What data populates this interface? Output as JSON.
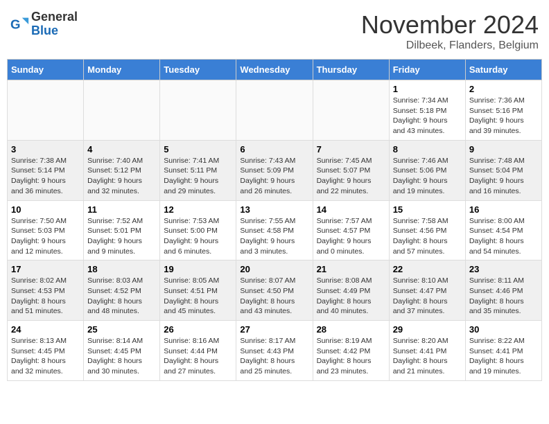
{
  "logo": {
    "general": "General",
    "blue": "Blue"
  },
  "title": {
    "month": "November 2024",
    "location": "Dilbeek, Flanders, Belgium"
  },
  "headers": [
    "Sunday",
    "Monday",
    "Tuesday",
    "Wednesday",
    "Thursday",
    "Friday",
    "Saturday"
  ],
  "weeks": [
    [
      {
        "day": "",
        "info": ""
      },
      {
        "day": "",
        "info": ""
      },
      {
        "day": "",
        "info": ""
      },
      {
        "day": "",
        "info": ""
      },
      {
        "day": "",
        "info": ""
      },
      {
        "day": "1",
        "info": "Sunrise: 7:34 AM\nSunset: 5:18 PM\nDaylight: 9 hours and 43 minutes."
      },
      {
        "day": "2",
        "info": "Sunrise: 7:36 AM\nSunset: 5:16 PM\nDaylight: 9 hours and 39 minutes."
      }
    ],
    [
      {
        "day": "3",
        "info": "Sunrise: 7:38 AM\nSunset: 5:14 PM\nDaylight: 9 hours and 36 minutes."
      },
      {
        "day": "4",
        "info": "Sunrise: 7:40 AM\nSunset: 5:12 PM\nDaylight: 9 hours and 32 minutes."
      },
      {
        "day": "5",
        "info": "Sunrise: 7:41 AM\nSunset: 5:11 PM\nDaylight: 9 hours and 29 minutes."
      },
      {
        "day": "6",
        "info": "Sunrise: 7:43 AM\nSunset: 5:09 PM\nDaylight: 9 hours and 26 minutes."
      },
      {
        "day": "7",
        "info": "Sunrise: 7:45 AM\nSunset: 5:07 PM\nDaylight: 9 hours and 22 minutes."
      },
      {
        "day": "8",
        "info": "Sunrise: 7:46 AM\nSunset: 5:06 PM\nDaylight: 9 hours and 19 minutes."
      },
      {
        "day": "9",
        "info": "Sunrise: 7:48 AM\nSunset: 5:04 PM\nDaylight: 9 hours and 16 minutes."
      }
    ],
    [
      {
        "day": "10",
        "info": "Sunrise: 7:50 AM\nSunset: 5:03 PM\nDaylight: 9 hours and 12 minutes."
      },
      {
        "day": "11",
        "info": "Sunrise: 7:52 AM\nSunset: 5:01 PM\nDaylight: 9 hours and 9 minutes."
      },
      {
        "day": "12",
        "info": "Sunrise: 7:53 AM\nSunset: 5:00 PM\nDaylight: 9 hours and 6 minutes."
      },
      {
        "day": "13",
        "info": "Sunrise: 7:55 AM\nSunset: 4:58 PM\nDaylight: 9 hours and 3 minutes."
      },
      {
        "day": "14",
        "info": "Sunrise: 7:57 AM\nSunset: 4:57 PM\nDaylight: 9 hours and 0 minutes."
      },
      {
        "day": "15",
        "info": "Sunrise: 7:58 AM\nSunset: 4:56 PM\nDaylight: 8 hours and 57 minutes."
      },
      {
        "day": "16",
        "info": "Sunrise: 8:00 AM\nSunset: 4:54 PM\nDaylight: 8 hours and 54 minutes."
      }
    ],
    [
      {
        "day": "17",
        "info": "Sunrise: 8:02 AM\nSunset: 4:53 PM\nDaylight: 8 hours and 51 minutes."
      },
      {
        "day": "18",
        "info": "Sunrise: 8:03 AM\nSunset: 4:52 PM\nDaylight: 8 hours and 48 minutes."
      },
      {
        "day": "19",
        "info": "Sunrise: 8:05 AM\nSunset: 4:51 PM\nDaylight: 8 hours and 45 minutes."
      },
      {
        "day": "20",
        "info": "Sunrise: 8:07 AM\nSunset: 4:50 PM\nDaylight: 8 hours and 43 minutes."
      },
      {
        "day": "21",
        "info": "Sunrise: 8:08 AM\nSunset: 4:49 PM\nDaylight: 8 hours and 40 minutes."
      },
      {
        "day": "22",
        "info": "Sunrise: 8:10 AM\nSunset: 4:47 PM\nDaylight: 8 hours and 37 minutes."
      },
      {
        "day": "23",
        "info": "Sunrise: 8:11 AM\nSunset: 4:46 PM\nDaylight: 8 hours and 35 minutes."
      }
    ],
    [
      {
        "day": "24",
        "info": "Sunrise: 8:13 AM\nSunset: 4:45 PM\nDaylight: 8 hours and 32 minutes."
      },
      {
        "day": "25",
        "info": "Sunrise: 8:14 AM\nSunset: 4:45 PM\nDaylight: 8 hours and 30 minutes."
      },
      {
        "day": "26",
        "info": "Sunrise: 8:16 AM\nSunset: 4:44 PM\nDaylight: 8 hours and 27 minutes."
      },
      {
        "day": "27",
        "info": "Sunrise: 8:17 AM\nSunset: 4:43 PM\nDaylight: 8 hours and 25 minutes."
      },
      {
        "day": "28",
        "info": "Sunrise: 8:19 AM\nSunset: 4:42 PM\nDaylight: 8 hours and 23 minutes."
      },
      {
        "day": "29",
        "info": "Sunrise: 8:20 AM\nSunset: 4:41 PM\nDaylight: 8 hours and 21 minutes."
      },
      {
        "day": "30",
        "info": "Sunrise: 8:22 AM\nSunset: 4:41 PM\nDaylight: 8 hours and 19 minutes."
      }
    ]
  ]
}
